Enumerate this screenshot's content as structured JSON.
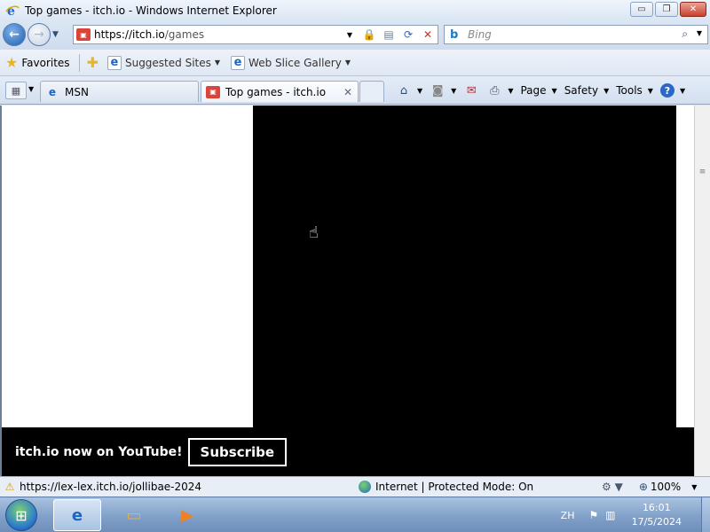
{
  "window": {
    "title": "Top games - itch.io - Windows Internet Explorer",
    "buttons": {
      "minimize": "▭",
      "maximize": "❐",
      "close": "✕"
    }
  },
  "address": {
    "url_host": "https://itch.io",
    "url_path": "/games",
    "search_placeholder": "Bing"
  },
  "favorites_bar": {
    "favorites_label": "Favorites",
    "links": [
      {
        "label": "Suggested Sites"
      },
      {
        "label": "Web Slice Gallery"
      }
    ]
  },
  "tabs": [
    {
      "label": "MSN"
    },
    {
      "label": "Top games - itch.io"
    }
  ],
  "command_bar": {
    "page": "Page",
    "safety": "Safety",
    "tools": "Tools",
    "help": "?"
  },
  "page": {
    "banner_text": "itch.io now on YouTube!",
    "subscribe_label": "Subscribe"
  },
  "status": {
    "url": "https://lex-lex.itch.io/jollibae-2024",
    "zone": "Internet | Protected Mode: On",
    "zoom": "100%"
  },
  "taskbar": {
    "language": "ZH",
    "time": "16:01",
    "date": "17/5/2024"
  },
  "colors": {
    "banner_bg": "#000000",
    "accent": "#1d66c2"
  }
}
